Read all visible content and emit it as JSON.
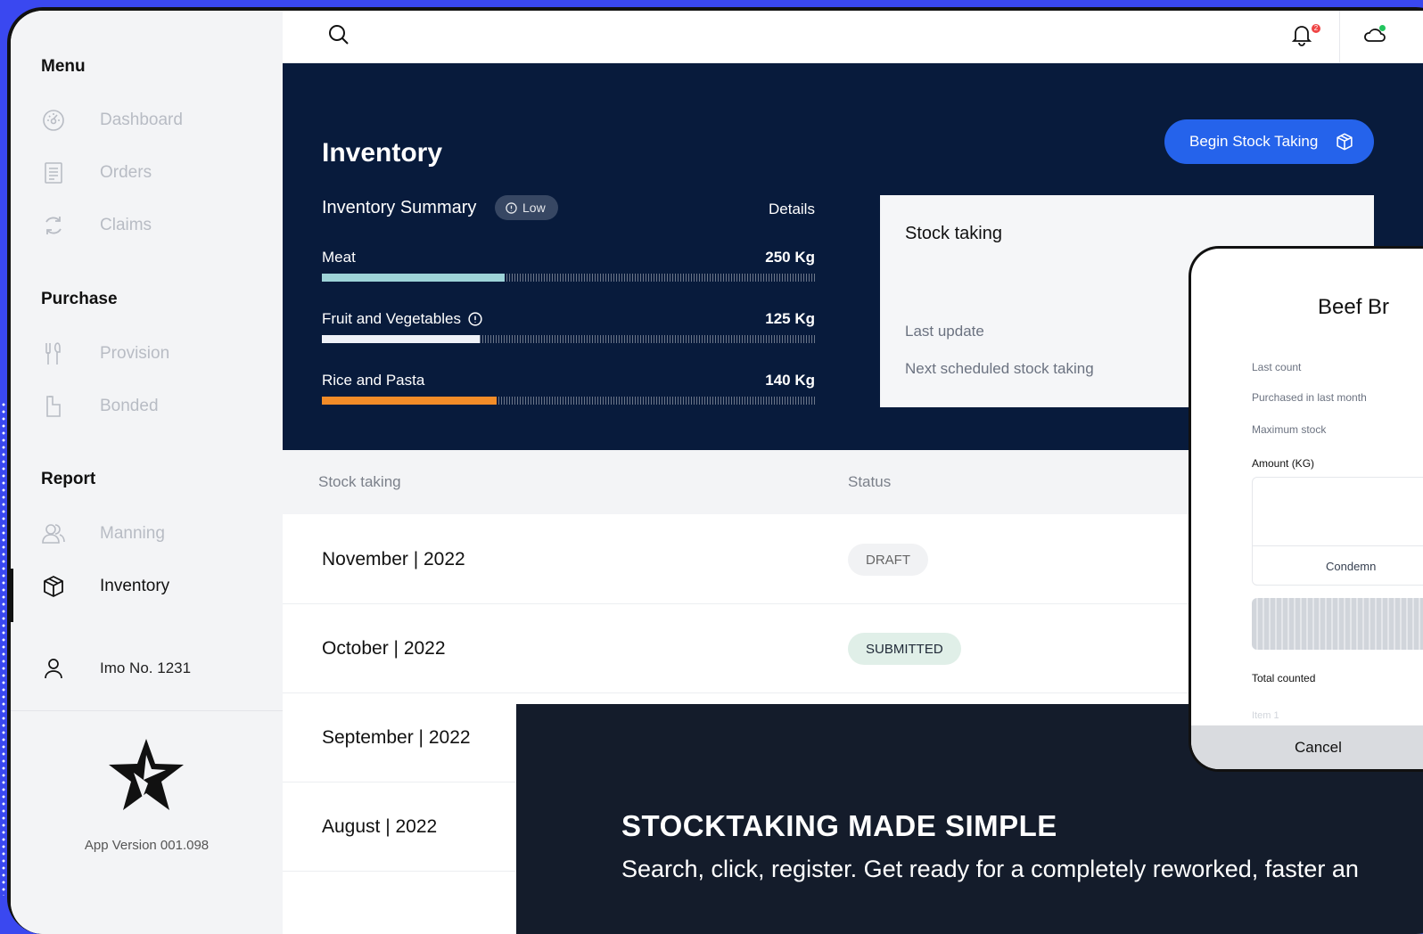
{
  "sidebar": {
    "menu_title": "Menu",
    "menu_items": [
      {
        "label": "Dashboard",
        "icon": "gauge-icon"
      },
      {
        "label": "Orders",
        "icon": "receipt-icon"
      },
      {
        "label": "Claims",
        "icon": "refresh-icon"
      }
    ],
    "purchase_title": "Purchase",
    "purchase_items": [
      {
        "label": "Provision",
        "icon": "fork-knife-icon"
      },
      {
        "label": "Bonded",
        "icon": "bottle-icon"
      }
    ],
    "report_title": "Report",
    "report_items": [
      {
        "label": "Manning",
        "icon": "crew-icon"
      },
      {
        "label": "Inventory",
        "icon": "box-icon",
        "active": true
      }
    ],
    "user_label": "Imo No. 1231",
    "app_version": "App Version 001.098"
  },
  "topbar": {
    "notification_count": "2"
  },
  "hero": {
    "title": "Inventory",
    "begin_button": "Begin Stock Taking",
    "summary_title": "Inventory Summary",
    "low_badge": "Low",
    "details_link": "Details",
    "items": [
      {
        "name": "Meat",
        "amount": "250 Kg",
        "fill": 0.37,
        "color": "#9dd3d8"
      },
      {
        "name": "Fruit and Vegetables",
        "amount": "125 Kg",
        "fill": 0.32,
        "color": "#eef1f7"
      },
      {
        "name": "Rice and Pasta",
        "amount": "140 Kg",
        "fill": 0.355,
        "color": "#f28c28"
      }
    ],
    "stock_card": {
      "title": "Stock taking",
      "last_update": "Last update",
      "next_scheduled": "Next scheduled stock taking"
    }
  },
  "table": {
    "headers": {
      "period": "Stock taking",
      "status": "Status"
    },
    "rows": [
      {
        "period": "November | 2022",
        "status": "DRAFT"
      },
      {
        "period": "October | 2022",
        "status": "SUBMITTED"
      },
      {
        "period": "September | 2022",
        "status": ""
      },
      {
        "period": "August | 2022",
        "status": ""
      }
    ]
  },
  "banner": {
    "headline": "STOCKTAKING MADE SIMPLE",
    "text": "Search, click, register. Get ready for a completely reworked, faster an"
  },
  "phone": {
    "title": "Beef Br",
    "last_count": "Last count",
    "purchased": "Purchased in last month",
    "max_stock": "Maximum stock",
    "amount_label": "Amount (KG)",
    "condemn": "Condemn",
    "total_counted": "Total counted",
    "item_placeholder": "Item 1",
    "cancel": "Cancel"
  }
}
